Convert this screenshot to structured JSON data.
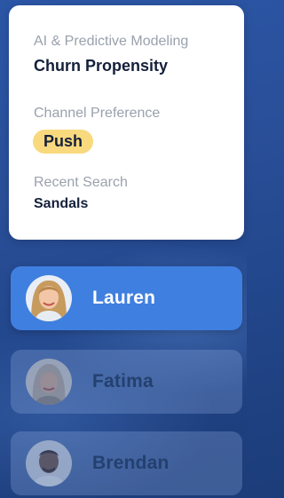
{
  "profile_card": {
    "model_label": "AI & Predictive Modeling",
    "model_value": "Churn Propensity",
    "channel_label": "Channel Preference",
    "channel_value": "Push",
    "search_label": "Recent Search",
    "search_value": "Sandals"
  },
  "people": [
    {
      "name": "Lauren",
      "selected": true
    },
    {
      "name": "Fatima",
      "selected": false
    },
    {
      "name": "Brendan",
      "selected": false
    }
  ],
  "colors": {
    "background": "#2a4f99",
    "card": "#ffffff",
    "chip": "#f8d97e",
    "selected": "#3f7fe0"
  }
}
